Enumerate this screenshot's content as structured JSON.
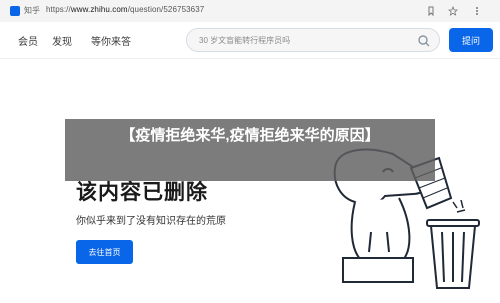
{
  "browser": {
    "site_label": "知乎",
    "url_prefix": "https://",
    "url_host": "www.zhihu.com",
    "url_path": "/question/526753637"
  },
  "nav": {
    "items": [
      "会员",
      "发现",
      "等你来答"
    ],
    "search_placeholder": "30 岁文盲能转行程序员吗",
    "ask_label": "提问"
  },
  "overlay": {
    "headline": "【疫情拒绝来华,疫情拒绝来华的原因】"
  },
  "main": {
    "title": "该内容已删除",
    "subtitle": "你似乎来到了没有知识存在的荒原",
    "home_button": "去往首页"
  },
  "colors": {
    "accent": "#0a66e8",
    "overlay": "#5f5f5f"
  }
}
